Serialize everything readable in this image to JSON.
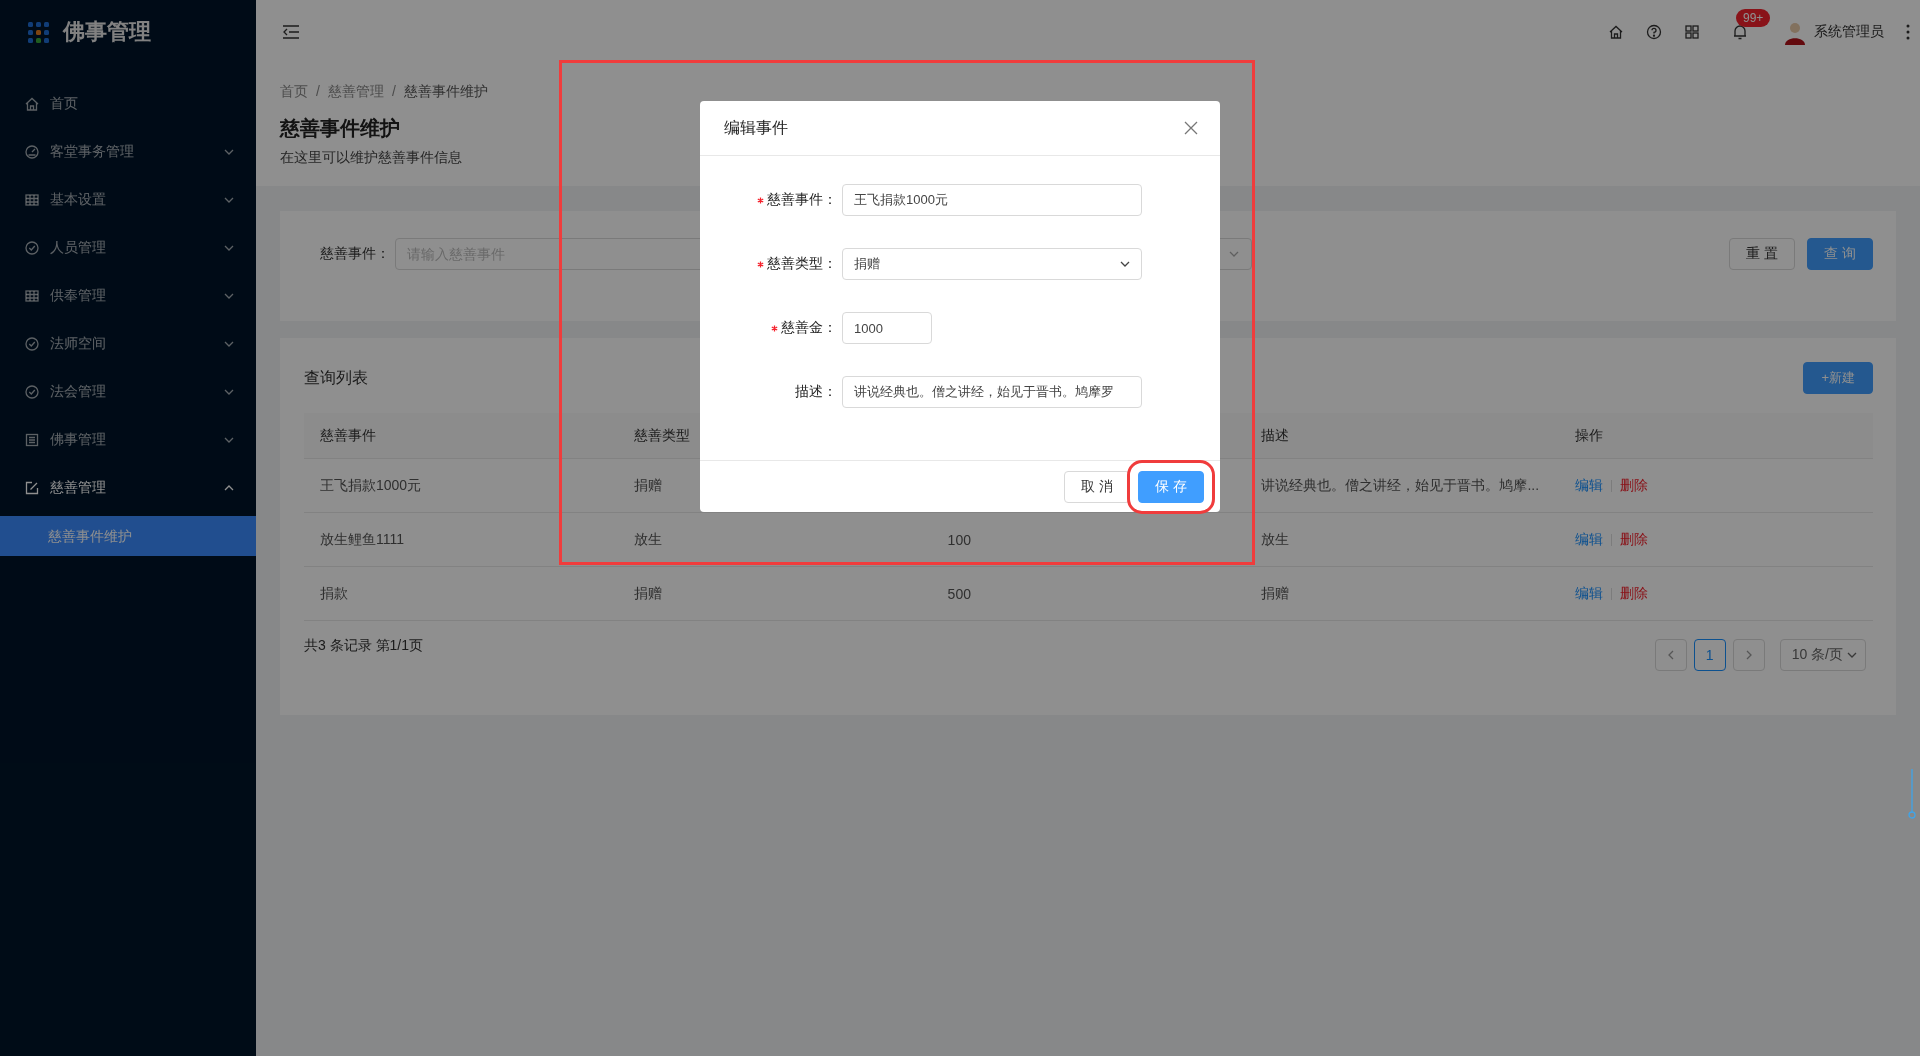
{
  "sidebar": {
    "logo": "佛事管理",
    "items": [
      {
        "kind": "link",
        "label": "首页"
      },
      {
        "kind": "group",
        "label": "客堂事务管理",
        "expanded": false
      },
      {
        "kind": "group",
        "label": "基本设置",
        "expanded": false
      },
      {
        "kind": "group",
        "label": "人员管理",
        "expanded": false
      },
      {
        "kind": "group",
        "label": "供奉管理",
        "expanded": false
      },
      {
        "kind": "group",
        "label": "法师空间",
        "expanded": false
      },
      {
        "kind": "group",
        "label": "法会管理",
        "expanded": false
      },
      {
        "kind": "group",
        "label": "佛事管理",
        "expanded": false
      },
      {
        "kind": "group",
        "label": "慈善管理",
        "expanded": true,
        "children": [
          {
            "label": "慈善事件维护",
            "selected": true
          }
        ]
      }
    ]
  },
  "header": {
    "notifications": "99+",
    "user": "系统管理员"
  },
  "breadcrumb": {
    "separator": "/",
    "items": [
      "首页",
      "慈善管理",
      "慈善事件维护"
    ]
  },
  "page_title": "慈善事件维护",
  "page_subtitle": "在这里可以维护慈善事件信息",
  "filters": [
    {
      "kind": "input",
      "label": "慈善事件：",
      "placeholder": "请输入慈善事件"
    },
    {
      "kind": "select"
    }
  ],
  "filter_buttons": [
    {
      "kind": "default",
      "label": "重 置"
    },
    {
      "kind": "primary",
      "label": "查 询"
    }
  ],
  "list": {
    "title": "查询列表",
    "new_button": "+新建",
    "columns": [
      "慈善事件",
      "慈善类型",
      null,
      "描述",
      "操作"
    ],
    "rows": [
      {
        "cells": [
          "王飞捐款1000元",
          "捐赠",
          null,
          "讲说经典也。僧之讲经，始见于晋书。鸠摩..."
        ],
        "actions": [
          {
            "kind": "edit",
            "label": "编辑"
          },
          {
            "kind": "delete",
            "label": "删除"
          }
        ]
      },
      {
        "cells": [
          "放生鲤鱼1111",
          "放生",
          "100",
          "放生"
        ],
        "actions": [
          {
            "kind": "edit",
            "label": "编辑"
          },
          {
            "kind": "delete",
            "label": "删除"
          }
        ]
      },
      {
        "cells": [
          "捐款",
          "捐赠",
          "500",
          "捐赠"
        ],
        "actions": [
          {
            "kind": "edit",
            "label": "编辑"
          },
          {
            "kind": "delete",
            "label": "删除"
          }
        ]
      }
    ],
    "summary": "共3 条记录 第1/1页",
    "pages": [
      {
        "label": "1",
        "selected": true
      }
    ],
    "page_size": "10 条/页"
  },
  "dialog": {
    "title": "编辑事件",
    "highlighted": true,
    "fields": [
      {
        "kind": "input",
        "required": true,
        "label": "慈善事件：",
        "value": "王飞捐款1000元"
      },
      {
        "kind": "select",
        "required": true,
        "label": "慈善类型：",
        "value": "捐赠"
      },
      {
        "kind": "number",
        "required": true,
        "label": "慈善金：",
        "value": "1000"
      },
      {
        "kind": "input",
        "required": false,
        "label": "描述：",
        "value": "讲说经典也。僧之讲经，始见于晋书。鸠摩罗"
      }
    ],
    "buttons": [
      {
        "kind": "default",
        "label": "取 消",
        "highlighted": false
      },
      {
        "kind": "primary",
        "label": "保 存",
        "highlighted": true
      }
    ]
  }
}
